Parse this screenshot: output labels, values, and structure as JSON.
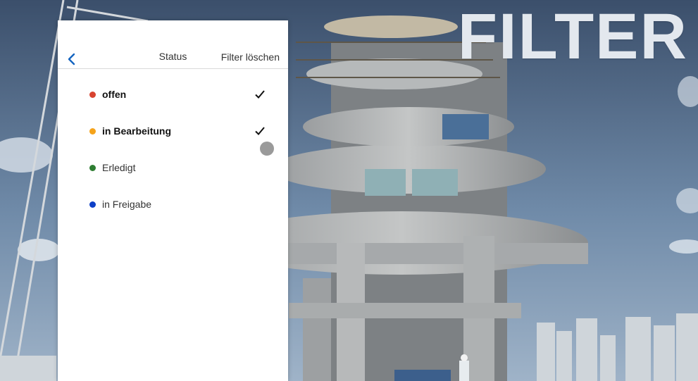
{
  "headline": "FILTER",
  "panel": {
    "title": "Status",
    "clear_label": "Filter löschen",
    "back_icon": "chevron-left-icon",
    "accent_color": "#1565c0"
  },
  "statuses": [
    {
      "label": "offen",
      "color": "#d84330",
      "selected": true
    },
    {
      "label": "in Bearbeitung",
      "color": "#f5a31a",
      "selected": true
    },
    {
      "label": "Erledigt",
      "color": "#2e7d32",
      "selected": false
    },
    {
      "label": "in Freigabe",
      "color": "#0d3fc7",
      "selected": false
    }
  ]
}
